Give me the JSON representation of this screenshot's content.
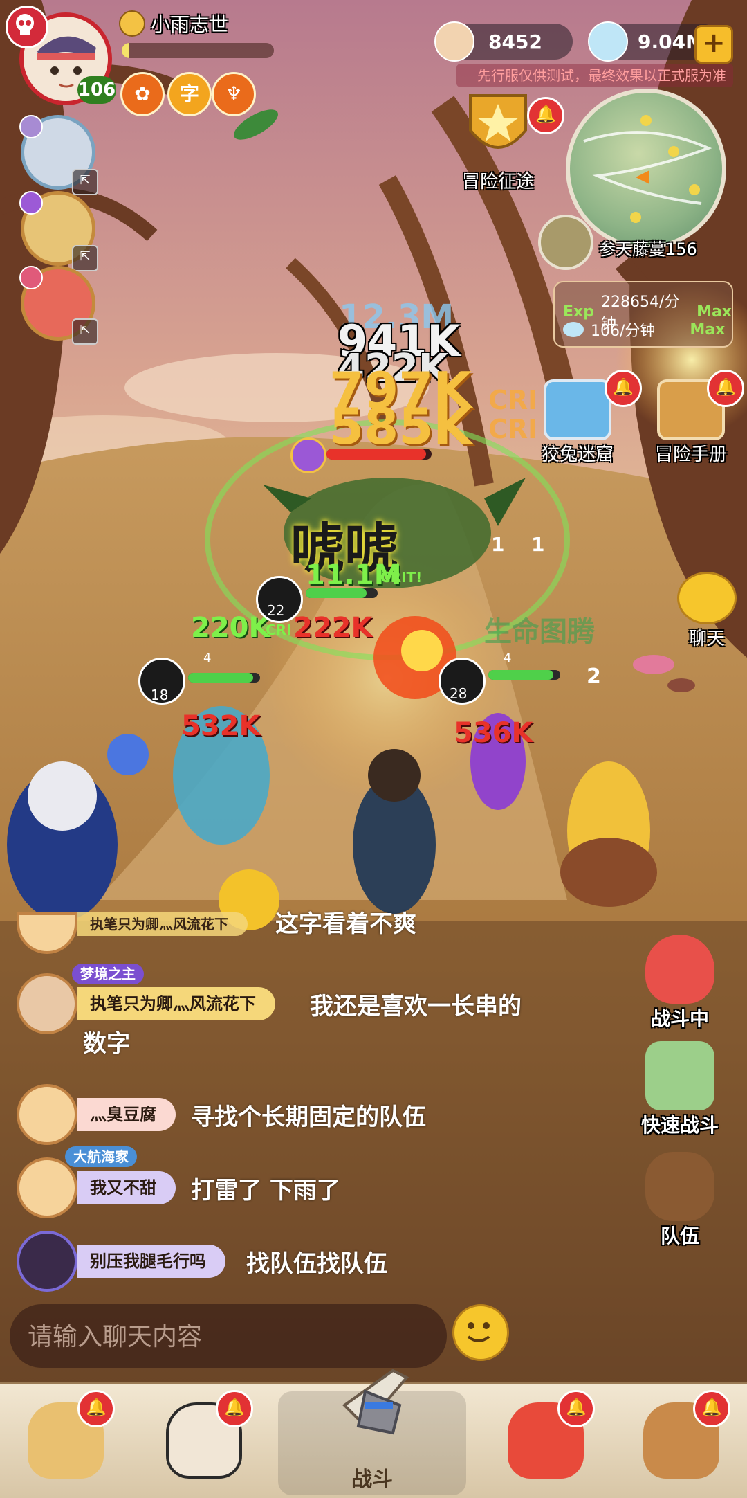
{
  "player": {
    "name": "小雨志世",
    "level": "106",
    "xp_progress": 0.05
  },
  "currency": {
    "shells": "8452",
    "gems": "9.04M"
  },
  "notice": "先行服仅供测试，最终效果以正式服为准",
  "features": {
    "adventure_journey": "冒险征途",
    "map_location": "参天藤蔓156",
    "maze": "狡兔迷窟",
    "handbook": "冒险手册",
    "chat": "聊天"
  },
  "rates": {
    "exp_label": "Exp",
    "exp_rate": "228654/分钟",
    "exp_max": "Max",
    "gem_rate": "106/分钟",
    "gem_max": "Max"
  },
  "battle": {
    "damage_numbers": [
      "12.3M",
      "941K",
      "422K",
      "797K",
      "585K",
      "CRI",
      "CRI",
      "11.1M",
      "CRIT!",
      "220K",
      "CRI",
      "222K",
      "532K",
      "536K"
    ],
    "shout": "唬唬",
    "boss_hp": 0.95,
    "ally_levels": [
      "22",
      "18",
      "28"
    ],
    "ally_hp": [
      0.85,
      0.9,
      0.9
    ],
    "totem_text": "生命图腾",
    "stack_counts": [
      "1",
      "1",
      "4",
      "4",
      "2"
    ]
  },
  "chat": {
    "messages": [
      {
        "name": "执笔只为卿灬风流花下",
        "title": "",
        "text": "这字看着不爽",
        "name_bg": "#f5d77a",
        "partial": true
      },
      {
        "name": "执笔只为卿灬风流花下",
        "title": "梦境之主",
        "text": "我还是喜欢一长串的",
        "continuation": "数字",
        "name_bg": "#f5d77a"
      },
      {
        "name": "灬臭豆腐",
        "title": "",
        "text": "寻找个长期固定的队伍",
        "name_bg": "#fbd9d2"
      },
      {
        "name": "我又不甜",
        "title": "大航海家",
        "text": "打雷了 下雨了",
        "name_bg": "#d9ccf5"
      },
      {
        "name": "别压我腿毛行吗",
        "title": "",
        "text": "找队伍找队伍",
        "name_bg": "#d9ccf5"
      }
    ],
    "input_placeholder": "请输入聊天内容"
  },
  "side_buttons": {
    "in_battle": "战斗中",
    "quick_battle": "快速战斗",
    "team": "队伍"
  },
  "bottom_nav": {
    "center_label": "战斗"
  },
  "colors": {
    "accent_red": "#e23234",
    "gold": "#f6bd2b",
    "crit_green": "#7ef04a",
    "damage_red": "#e8322a",
    "damage_gold": "#f5c040"
  }
}
